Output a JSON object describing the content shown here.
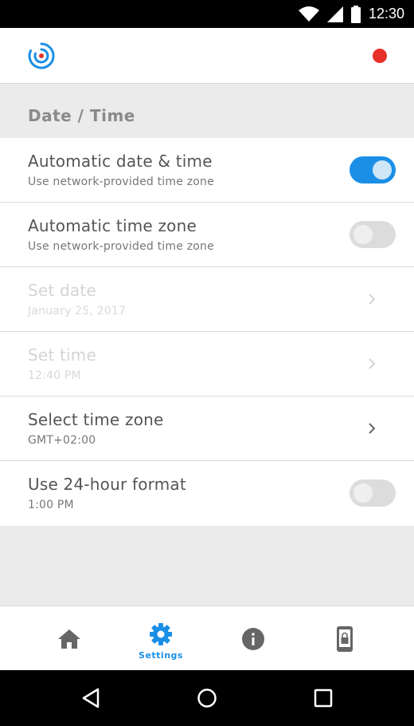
{
  "status_bar": {
    "time": "12:30",
    "icons": [
      "wifi-icon",
      "signal-icon",
      "battery-icon"
    ]
  },
  "app_bar": {
    "logo": "app-logo",
    "notification_dot_color": "#e8302a"
  },
  "section": {
    "title": "Date / Time"
  },
  "settings": [
    {
      "title": "Automatic date & time",
      "subtitle": "Use network-provided time zone",
      "control": "toggle",
      "state": "on",
      "enabled": true
    },
    {
      "title": "Automatic time zone",
      "subtitle": "Use network-provided time zone",
      "control": "toggle",
      "state": "off",
      "enabled": true
    },
    {
      "title": "Set date",
      "subtitle": "January 25, 2017",
      "control": "chevron",
      "enabled": false
    },
    {
      "title": "Set time",
      "subtitle": "12:40 PM",
      "control": "chevron",
      "enabled": false
    },
    {
      "title": "Select time zone",
      "subtitle": "GMT+02:00",
      "control": "chevron",
      "enabled": true
    },
    {
      "title": "Use 24-hour format",
      "subtitle": "1:00 PM",
      "control": "toggle",
      "state": "off",
      "enabled": true
    }
  ],
  "bottom_nav": {
    "items": [
      {
        "icon": "home-icon",
        "label": "",
        "active": false
      },
      {
        "icon": "gear-icon",
        "label": "Settings",
        "active": true
      },
      {
        "icon": "info-icon",
        "label": "",
        "active": false
      },
      {
        "icon": "device-lock-icon",
        "label": "",
        "active": false
      }
    ]
  },
  "system_nav": {
    "buttons": [
      "back-icon",
      "home-circle-icon",
      "recents-icon"
    ]
  },
  "colors": {
    "accent": "#1b8fe6",
    "background": "#ebebeb",
    "notification": "#e8302a"
  }
}
